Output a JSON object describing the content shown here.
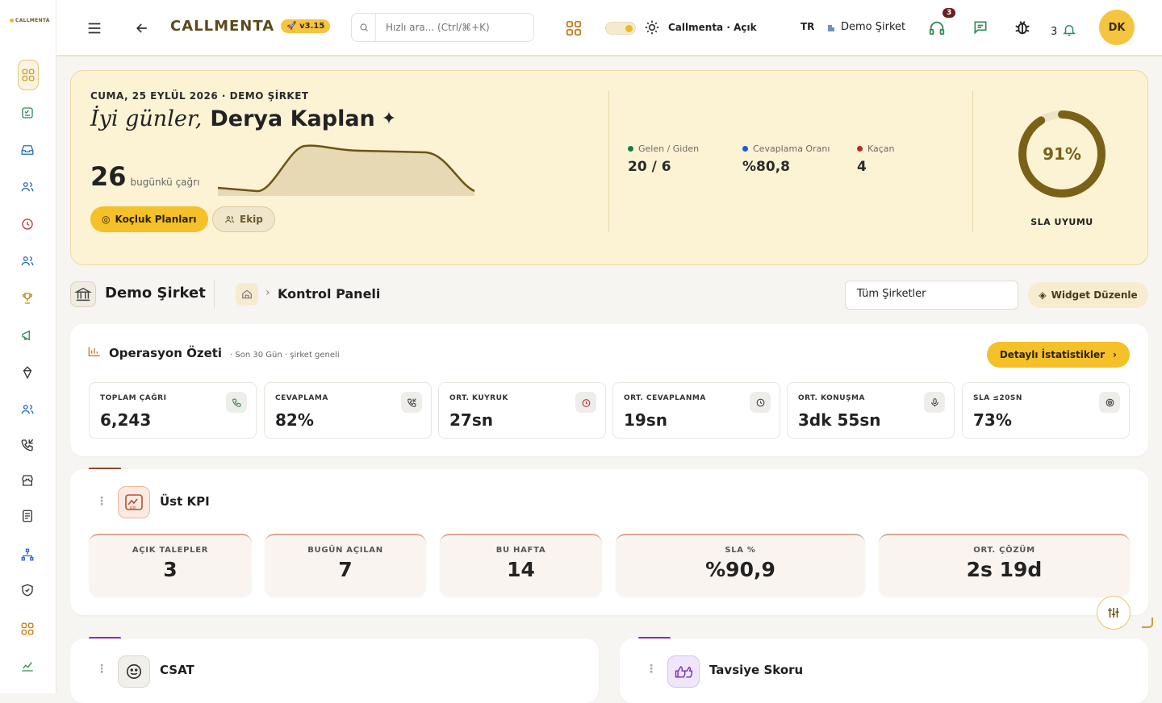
{
  "sidebar": {
    "logo": "CALLMENTA",
    "items": [
      "dashboard-icon",
      "checklist-icon",
      "inbox-icon",
      "users-icon",
      "clock-icon",
      "team-icon",
      "trophy-icon",
      "megaphone-icon",
      "gem-icon",
      "agents-icon",
      "phone-incoming-icon",
      "store-icon",
      "document-icon",
      "sitemap-icon",
      "shield-icon",
      "widgets-icon",
      "chart-icon"
    ]
  },
  "topbar": {
    "brand": "CALLMENTA",
    "version": "v3.15",
    "search_placeholder": "Hızlı ara... (Ctrl/⌘+K)",
    "theme_label": "Callmenta · Açık",
    "lang": "TR",
    "company": "Demo Şirket",
    "headset_badge": "3",
    "notif_count": "3",
    "avatar": "DK"
  },
  "hero": {
    "date": "CUMA, 25 EYLÜL 2026 · DEMO ŞİRKET",
    "greeting": "İyi günler,",
    "name": "Derya Kaplan",
    "calls": "26",
    "calls_label": "bugünkü çağrı",
    "btn_coaching": "Koçluk Planları",
    "btn_team": "Ekip",
    "stats": [
      {
        "label": "Gelen / Giden",
        "value": "20 / 6",
        "color": "#1a7a45"
      },
      {
        "label": "Cevaplama Oranı",
        "value": "%80,8",
        "color": "#2457d6"
      },
      {
        "label": "Kaçan",
        "value": "4",
        "color": "#c0262b"
      }
    ],
    "sla_value": "91%",
    "sla_fraction": 0.91,
    "sla_label": "SLA UYUMU"
  },
  "breadcrumb": {
    "company": "Demo Şirket",
    "page": "Kontrol Paneli",
    "select": "Tüm Şirketler",
    "widget_btn": "Widget Düzenle"
  },
  "ops": {
    "title": "Operasyon Özeti",
    "subtitle": "· Son 30 Gün · şirket geneli",
    "details_btn": "Detaylı İstatistikler",
    "kpis": [
      {
        "label": "TOPLAM ÇAĞRI",
        "value": "6,243"
      },
      {
        "label": "CEVAPLAMA",
        "value": "82%"
      },
      {
        "label": "ORT. KUYRUK",
        "value": "27sn"
      },
      {
        "label": "ORT. CEVAPLANMA",
        "value": "19sn"
      },
      {
        "label": "ORT. KONUŞMA",
        "value": "3dk 55sn"
      },
      {
        "label": "SLA ≤20SN",
        "value": "73%"
      }
    ]
  },
  "ust_kpi": {
    "title": "Üst KPI",
    "boxes": [
      {
        "label": "AÇIK TALEPLER",
        "value": "3"
      },
      {
        "label": "BUGÜN AÇILAN",
        "value": "7"
      },
      {
        "label": "BU HAFTA",
        "value": "14"
      },
      {
        "label": "SLA %",
        "value": "%90,9"
      },
      {
        "label": "ORT. ÇÖZÜM",
        "value": "2s 19d"
      }
    ]
  },
  "csat": {
    "title": "CSAT"
  },
  "tavsiye": {
    "title": "Tavsiye Skoru"
  }
}
